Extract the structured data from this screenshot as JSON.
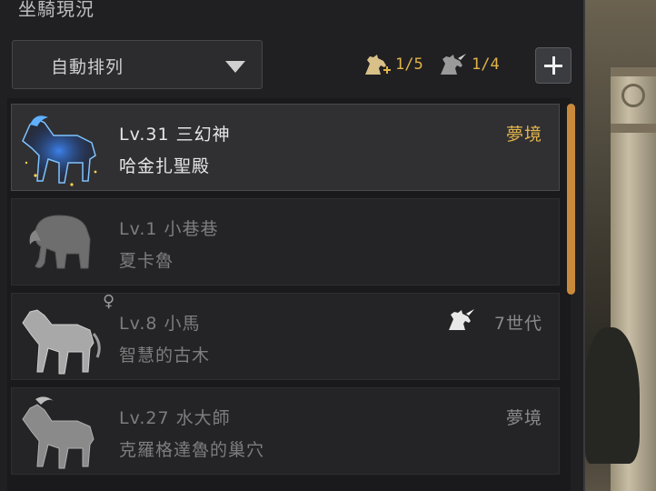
{
  "panel": {
    "title": "坐騎現況"
  },
  "sort": {
    "label": "自動排列"
  },
  "counters": [
    {
      "icon": "horse-head-icon",
      "value": "1/5"
    },
    {
      "icon": "unicorn-head-icon",
      "value": "1/4"
    }
  ],
  "add_button_icon": "plus-icon",
  "colors": {
    "accent": "#e1b34a",
    "scrollbar": "#c98a3c",
    "panel_bg": "#202022"
  },
  "mounts": [
    {
      "name": "Lv.31 三幻神",
      "location": "哈金扎聖殿",
      "tag": "夢境",
      "thumb": "blue-spirit-horse",
      "selected": true
    },
    {
      "name": "Lv.1 小巷巷",
      "location": "夏卡魯",
      "tag": "",
      "thumb": "elephant",
      "selected": false
    },
    {
      "name": "Lv.8 小馬",
      "location": "智慧的古木",
      "tag": "7世代",
      "gender": "♀",
      "thumb": "white-horse",
      "selected": false
    },
    {
      "name": "Lv.27 水大師",
      "location": "克羅格達魯的巢穴",
      "tag": "夢境",
      "thumb": "grey-horse",
      "selected": false
    }
  ]
}
